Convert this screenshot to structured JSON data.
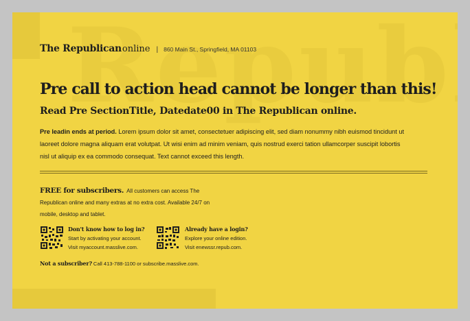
{
  "header": {
    "logo": "The Republican",
    "logo_suffix": "online",
    "separator": "|",
    "address": "860 Main St., Springfield, MA 01103"
  },
  "headline": "Pre call to action head cannot be longer than this!",
  "subhead": "Read Pre SectionTitle, Datedate00 in The Republican online.",
  "body": {
    "lead": "Pre leadin ends at period.",
    "text": " Lorem ipsum dolor sit amet, consectetuer adipiscing elit, sed diam nonummy nibh euismod tincidunt ut laoreet dolore magna aliquam erat volutpat. Ut wisi enim ad minim veniam, quis nostrud exerci tation ullamcorper suscipit lobortis nisl ut aliquip ex ea commodo consequat. Text cannot exceed this length."
  },
  "free": {
    "head": "FREE for subscribers.",
    "text": "All customers can access The Republican online and many extras at no extra cost. Available 24/7 on mobile, desktop and tablet."
  },
  "qr_blocks": [
    {
      "head": "Don't know how to log in?",
      "line1": "Start by activating your account.",
      "line2": "Visit myaccount.masslive.com."
    },
    {
      "head": "Already have a login?",
      "line1": "Explore your online edition.",
      "line2": "Visit enewssr.repub.com."
    }
  ],
  "not_subscriber": {
    "head": "Not a subscriber?",
    "text": " Call 413-788-1100 or subscribe.masslive.com."
  },
  "icons": [
    "qr-code-icon",
    "qr-code-icon"
  ],
  "colors": {
    "card": "#f1d443",
    "frame": "#c4c4c4",
    "text": "#1e1e1e"
  }
}
